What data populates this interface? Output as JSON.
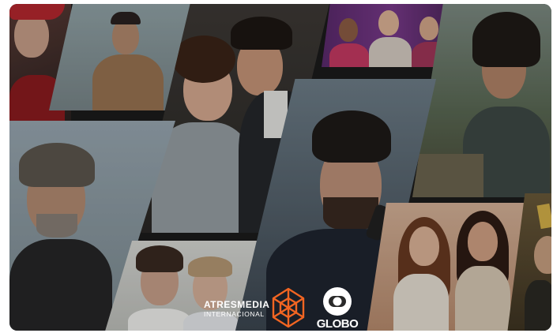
{
  "banner": {
    "logos": {
      "atresmedia_line1": "ATRESMEDIA",
      "atresmedia_line2": "INTERNACIONAL",
      "globo_text": "GLOBO"
    },
    "colors": {
      "background": "#1b1b1b",
      "logo_text": "#ffffff",
      "atres_mark": "#f26522"
    },
    "icons": [
      "atresmedia-star-icon",
      "globo-sphere-icon"
    ]
  }
}
